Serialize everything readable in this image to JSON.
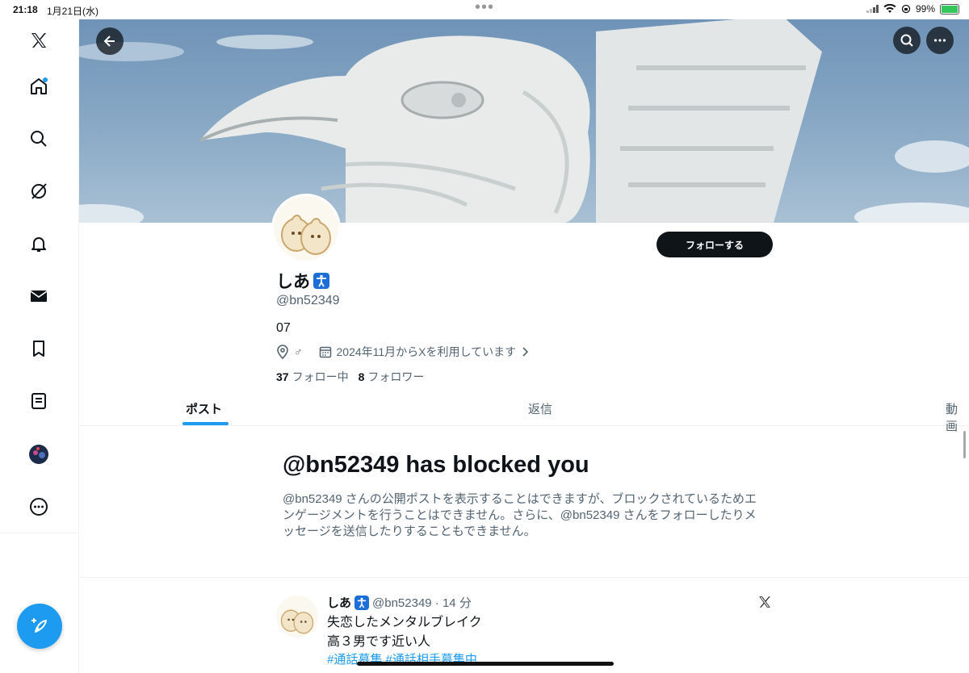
{
  "status_bar": {
    "time": "21:18",
    "date": "1月21日(水)",
    "battery": "99%"
  },
  "sidebar": {
    "items": [
      "x-logo-icon",
      "home-icon",
      "search-icon",
      "grok-icon",
      "notifications-icon",
      "messages-icon",
      "bookmarks-icon",
      "lists-icon",
      "profile-avatar",
      "more-icon"
    ]
  },
  "profile": {
    "display_name": "しあ",
    "handle": "@bn52349",
    "bio": "07",
    "gender_mark": "♂",
    "joined": "2024年11月からXを利用しています",
    "following_count": "37",
    "following_label": "フォロー中",
    "followers_count": "8",
    "followers_label": "フォロワー",
    "follow_button": "フォローする"
  },
  "tabs": [
    {
      "label": "ポスト",
      "active": true
    },
    {
      "label": "返信",
      "active": false
    },
    {
      "label": "動画",
      "active": false
    }
  ],
  "blocked": {
    "title": "@bn52349 has blocked you",
    "description": "@bn52349 さんの公開ポストを表示することはできますが、ブロックされているためエンゲージメントを行うことはできません。さらに、@bn52349 さんをフォローしたりメッセージを送信したりすることもできません。"
  },
  "post": {
    "name": "しあ",
    "handle_time": "@bn52349 · 14 分",
    "line1": "失恋したメンタルブレイク",
    "line2": "高３男です近い人",
    "tags": "#通話募集 #通話相手募集中"
  },
  "colors": {
    "accent": "#1d9bf0",
    "text": "#0f1419",
    "muted": "#536471"
  }
}
